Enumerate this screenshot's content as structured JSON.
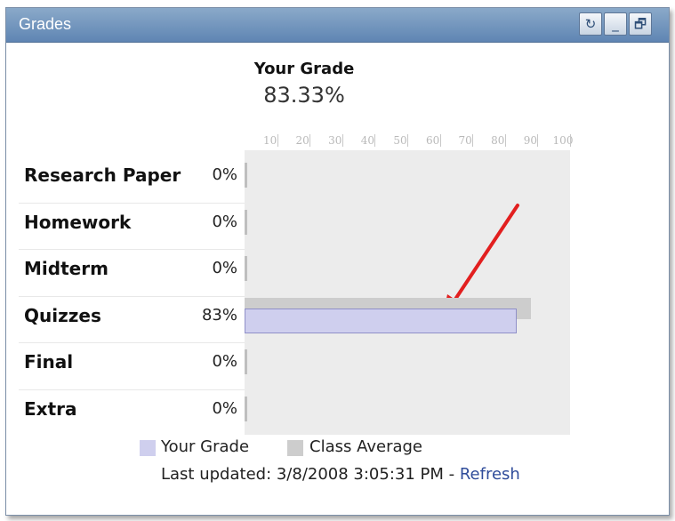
{
  "window": {
    "title": "Grades",
    "buttons": [
      {
        "name": "refresh-icon",
        "glyph": "↻"
      },
      {
        "name": "minimize-icon",
        "glyph": "_"
      },
      {
        "name": "restore-icon",
        "glyph": "🗗"
      }
    ]
  },
  "summary": {
    "label": "Your Grade",
    "value": "83.33%"
  },
  "chart_data": {
    "type": "bar",
    "orientation": "horizontal",
    "categories": [
      "Research Paper",
      "Homework",
      "Midterm",
      "Quizzes",
      "Final",
      "Extra"
    ],
    "percent_labels": [
      "0%",
      "0%",
      "0%",
      "83%",
      "0%",
      "0%"
    ],
    "series": [
      {
        "name": "Your Grade",
        "values": [
          0,
          0,
          0,
          83,
          0,
          0
        ],
        "color": "#cfcfee"
      },
      {
        "name": "Class Average",
        "values": [
          0,
          0,
          0,
          88,
          0,
          0
        ],
        "color": "#cdcdcd"
      }
    ],
    "x_ticks": [
      "10",
      "20",
      "30",
      "40",
      "50",
      "60",
      "70",
      "80",
      "90",
      "100"
    ],
    "xlim": [
      0,
      100
    ],
    "legend_position": "bottom"
  },
  "footer": {
    "prefix": "Last updated: 3/8/2008 3:05:31 PM - ",
    "link": "Refresh"
  },
  "annotation": {
    "name": "red-arrow",
    "color": "#e21f1f"
  }
}
